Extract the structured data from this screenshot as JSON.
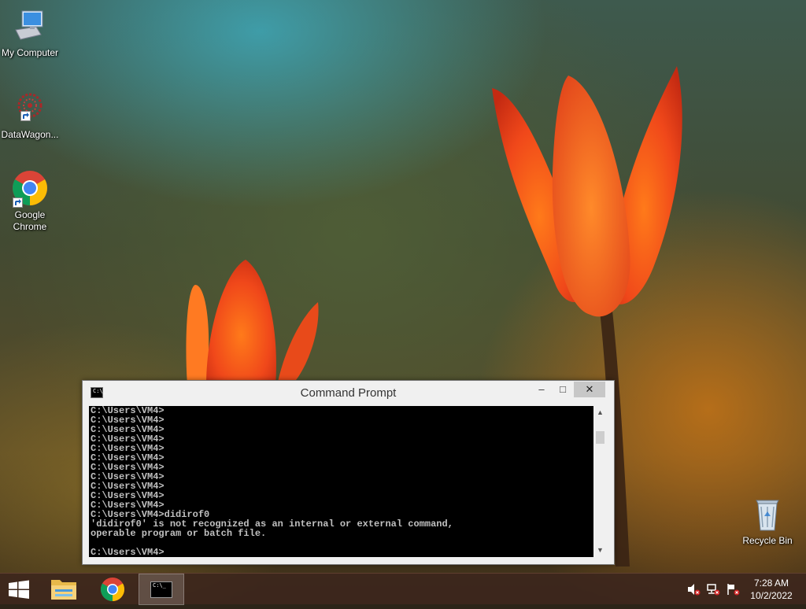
{
  "desktop": {
    "icons": [
      {
        "label": "My Computer"
      },
      {
        "label": "DataWagon..."
      },
      {
        "label": "Google Chrome"
      },
      {
        "label": "Recycle Bin"
      }
    ]
  },
  "cmd_window": {
    "title": "Command Prompt",
    "icon_glyph": "C:\\_",
    "controls": {
      "minimize": "–",
      "maximize": "□",
      "close": "✕"
    },
    "lines": [
      "C:\\Users\\VM4>",
      "C:\\Users\\VM4>",
      "C:\\Users\\VM4>",
      "C:\\Users\\VM4>",
      "C:\\Users\\VM4>",
      "C:\\Users\\VM4>",
      "C:\\Users\\VM4>",
      "C:\\Users\\VM4>",
      "C:\\Users\\VM4>",
      "C:\\Users\\VM4>",
      "C:\\Users\\VM4>",
      "C:\\Users\\VM4>didirof0",
      "'didirof0' is not recognized as an internal or external command,",
      "operable program or batch file.",
      "",
      "C:\\Users\\VM4>"
    ],
    "scrollbar": {
      "up": "▲",
      "down": "▼"
    }
  },
  "taskbar": {
    "items": [
      {
        "name": "Start",
        "icon": "windows-logo-icon"
      },
      {
        "name": "File Explorer",
        "icon": "folder-icon"
      },
      {
        "name": "Google Chrome",
        "icon": "chrome-icon"
      },
      {
        "name": "Command Prompt",
        "icon": "cmd-icon",
        "active": true
      }
    ],
    "cmd_glyph": "C:\\_",
    "tray": {
      "icons": [
        "speaker-muted-icon",
        "network-error-icon",
        "action-center-flag-icon"
      ],
      "time": "7:28 AM",
      "date": "10/2/2022"
    }
  },
  "colors": {
    "console_bg": "#000000",
    "console_fg": "#c0c0c0",
    "taskbar_bg": "#3c261c",
    "close_button": "#c7c7c7"
  }
}
